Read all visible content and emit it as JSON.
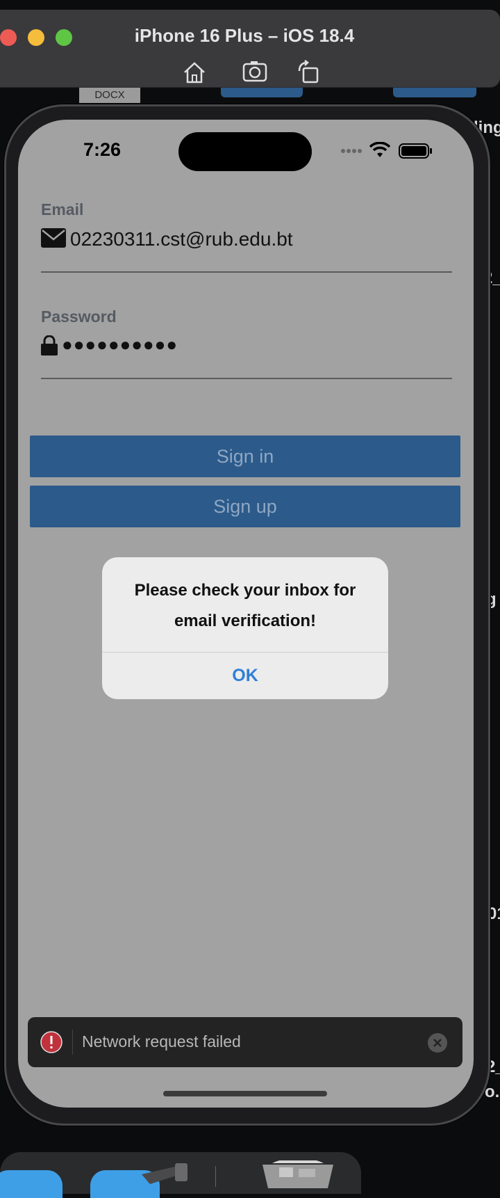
{
  "simulator": {
    "title": "iPhone 16 Plus – iOS 18.4"
  },
  "background": {
    "docx_label": "DOCX",
    "side_text_1": "ding",
    "side_text_2": "g",
    "side_text_3": "2_",
    "side_text_4": "01",
    "side_text_5": "2_",
    "side_text_6": "o.p"
  },
  "status": {
    "time": "7:26"
  },
  "form": {
    "email_label": "Email",
    "email_value": "02230311.cst@rub.edu.bt",
    "password_label": "Password",
    "password_value": "●●●●●●●●●●"
  },
  "buttons": {
    "sign_in": "Sign in",
    "sign_up": "Sign up"
  },
  "alert": {
    "message_line1": "Please check your inbox for",
    "message_line2": "email verification!",
    "ok": "OK"
  },
  "toast": {
    "message": "Network request failed"
  },
  "colors": {
    "primary": "#2c5a8a",
    "alert_button": "#2f7fd8",
    "error": "#c0333c"
  }
}
